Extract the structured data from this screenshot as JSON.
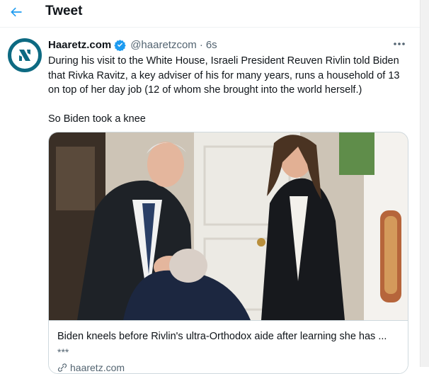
{
  "header": {
    "title": "Tweet",
    "back_icon": "arrow-left-icon",
    "accent": "#1d9bf0"
  },
  "tweet": {
    "author": {
      "display_name": "Haaretz.com",
      "handle": "@haaretzcom",
      "separator": "·",
      "time": "6s",
      "verified": true,
      "avatar_color": "#0d6a82"
    },
    "text": {
      "paragraph1": "During his visit to the White House, Israeli President Reuven Rivlin told Biden that Rivka Ravitz, a key adviser of his for many years, runs a household of 13 on top of her day job (12 of whom she brought into the world herself.)",
      "paragraph2": "So Biden took a knee"
    },
    "card": {
      "title": "Biden kneels before Rivlin's ultra-Orthodox aide after learning she has ...",
      "description": "***",
      "domain": "haaretz.com"
    }
  }
}
